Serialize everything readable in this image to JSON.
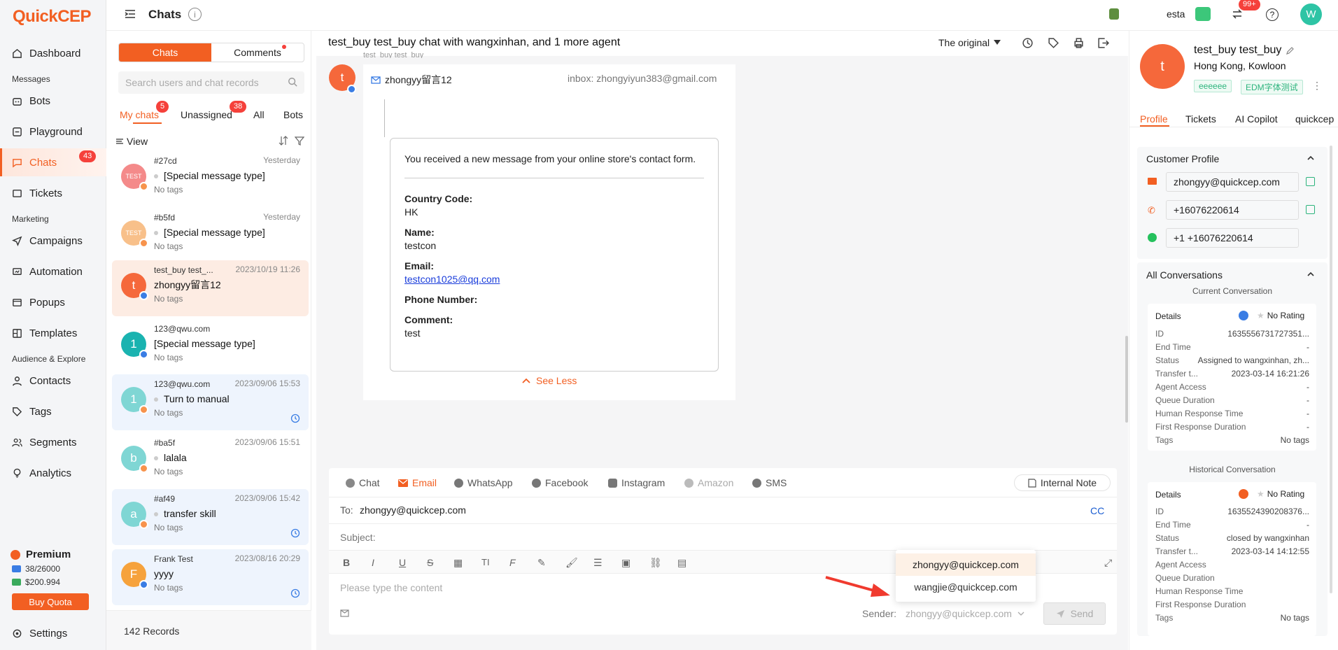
{
  "brand": {
    "logo": "QuickCEP",
    "accent": "#f25f22"
  },
  "nav": {
    "dashboard": "Dashboard",
    "messages": "Messages",
    "bots": "Bots",
    "playground": "Playground",
    "chats": "Chats",
    "chats_badge": "43",
    "tickets": "Tickets",
    "marketing": "Marketing",
    "campaigns": "Campaigns",
    "automation": "Automation",
    "popups": "Popups",
    "templates": "Templates",
    "audience": "Audience & Explore",
    "contacts": "Contacts",
    "tags": "Tags",
    "segments": "Segments",
    "analytics": "Analytics",
    "plan": "Premium",
    "quota_email": "38/26000",
    "quota_money": "$200.994",
    "buy": "Buy Quota",
    "settings": "Settings"
  },
  "topbar": {
    "title": "Chats",
    "store": "esta",
    "badge": "99+",
    "avatar": "W"
  },
  "list": {
    "seg_chats": "Chats",
    "seg_comments": "Comments",
    "search_placeholder": "Search users and chat records",
    "tab_my": "My chats",
    "tab_my_badge": "5",
    "tab_unassigned": "Unassigned",
    "tab_unassigned_badge": "38",
    "tab_all": "All",
    "tab_bots": "Bots",
    "view": "View",
    "records": "142 Records",
    "items": [
      {
        "name": "#27cd",
        "time": "Yesterday",
        "msg": "[Special message type]",
        "tags": "No tags",
        "avatar": "TEST"
      },
      {
        "name": "#b5fd",
        "time": "Yesterday",
        "msg": "[Special message type]",
        "tags": "No tags",
        "avatar": "TEST"
      },
      {
        "name": "test_buy test_...",
        "time": "2023/10/19 11:26",
        "msg": "zhongyy留言12",
        "tags": "No tags",
        "avatar": "t"
      },
      {
        "name": "123@qwu.com",
        "time": "",
        "msg": "[Special message type]",
        "tags": "No tags",
        "avatar": "1"
      },
      {
        "name": "123@qwu.com",
        "time": "2023/09/06 15:53",
        "msg": "Turn to manual",
        "tags": "No tags",
        "avatar": "1"
      },
      {
        "name": "#ba5f",
        "time": "2023/09/06 15:51",
        "msg": "lalala",
        "tags": "No tags",
        "avatar": "b"
      },
      {
        "name": "#af49",
        "time": "2023/09/06 15:42",
        "msg": "transfer skill",
        "tags": "No tags",
        "avatar": "a"
      },
      {
        "name": "Frank Test",
        "time": "2023/08/16 20:29",
        "msg": "yyyy",
        "tags": "No tags",
        "avatar": "F"
      }
    ]
  },
  "chat": {
    "header": "test_buy test_buy chat with wangxinhan, and 1 more agent",
    "original": "The original",
    "partial_name": "test_buy test_buy",
    "sender_avatar": "t",
    "mail_from": "zhongyy留言12",
    "inbox": "inbox: zhongyiyun383@gmail.com",
    "form_intro": "You received a new message from your online store's contact form.",
    "country_label": "Country Code:",
    "country": "HK",
    "name_label": "Name:",
    "name": "testcon",
    "email_label": "Email:",
    "email": "testcon1025@qq.com",
    "phone_label": "Phone Number:",
    "comment_label": "Comment:",
    "comment": "test",
    "see_less": "See Less"
  },
  "compose": {
    "tabs": [
      "Chat",
      "Email",
      "WhatsApp",
      "Facebook",
      "Instagram",
      "Amazon",
      "SMS"
    ],
    "internal_note": "Internal Note",
    "to_label": "To:",
    "to": "zhongyy@quickcep.com",
    "cc": "CC",
    "subject_label": "Subject:",
    "placeholder": "Please type the content",
    "sender_label": "Sender:",
    "sender": "zhongyy@quickcep.com",
    "send": "Send",
    "dropdown": [
      "zhongyy@quickcep.com",
      "wangjie@quickcep.com"
    ]
  },
  "profile": {
    "name": "test_buy test_buy",
    "location": "Hong Kong, Kowloon",
    "avatar": "t",
    "tag1": "eeeeee",
    "tag2": "EDM字体测试",
    "tabs": [
      "Profile",
      "Tickets",
      "AI Copilot",
      "quickcep"
    ],
    "customer_profile": "Customer Profile",
    "email": "zhongyy@quickcep.com",
    "phone": "+16076220614",
    "whatsapp": "+1 +16076220614",
    "all_conversations": "All Conversations",
    "current": "Current Conversation",
    "historical": "Historical Conversation",
    "details": "Details",
    "no_rating": "No Rating",
    "cur": {
      "id": "16355567317273​51...",
      "end": "-",
      "status": "Assigned to wangxinhan, zh...",
      "transfer": "2023-03-14 16:21:26",
      "access": "-",
      "queue": "-",
      "human": "-",
      "first": "-",
      "tags": "No tags"
    },
    "hist": {
      "id": "16355243902083​76...",
      "end": "-",
      "status": "closed by wangxinhan",
      "transfer": "2023-03-14 14:12:55",
      "access": "",
      "queue": "",
      "human": "",
      "first": "",
      "tags": "No tags"
    },
    "labels": {
      "id": "ID",
      "end": "End Time",
      "status": "Status",
      "transfer": "Transfer t...",
      "access": "Agent Access",
      "queue": "Queue Duration",
      "human": "Human Response Time",
      "first": "First Response Duration",
      "tags": "Tags"
    }
  }
}
